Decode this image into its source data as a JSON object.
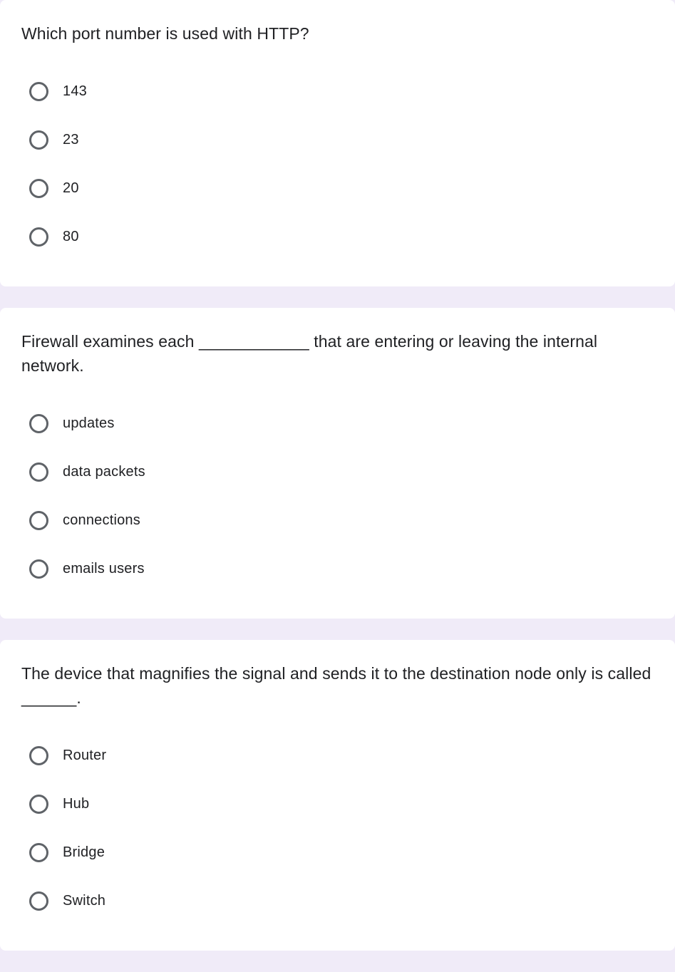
{
  "questions": [
    {
      "text": "Which port number is used with HTTP?",
      "options": [
        "143",
        "23",
        "20",
        "80"
      ]
    },
    {
      "text": "Firewall examines each ____________ that are entering or leaving the internal network.",
      "options": [
        "updates",
        "data packets",
        "connections",
        "emails users"
      ]
    },
    {
      "text": "The device that magnifies the signal and sends it to the destination node only is called ______.",
      "options": [
        "Router",
        "Hub",
        "Bridge",
        "Switch"
      ]
    }
  ]
}
